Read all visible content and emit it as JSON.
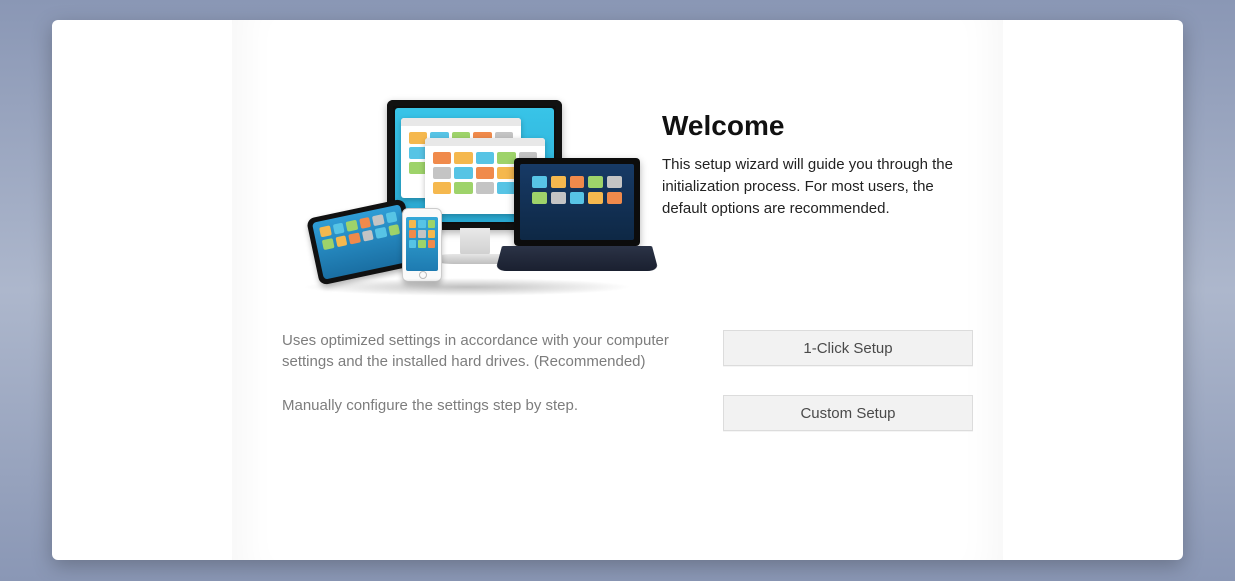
{
  "welcome": {
    "title": "Welcome",
    "description": "This setup wizard will guide you through the initialization process. For most users, the default options are recommended."
  },
  "options": {
    "quick": {
      "description": "Uses optimized settings in accordance with your computer settings and the installed hard drives. (Recommended)",
      "button_label": "1-Click Setup"
    },
    "custom": {
      "description": "Manually configure the settings step by step.",
      "button_label": "Custom Setup"
    }
  }
}
